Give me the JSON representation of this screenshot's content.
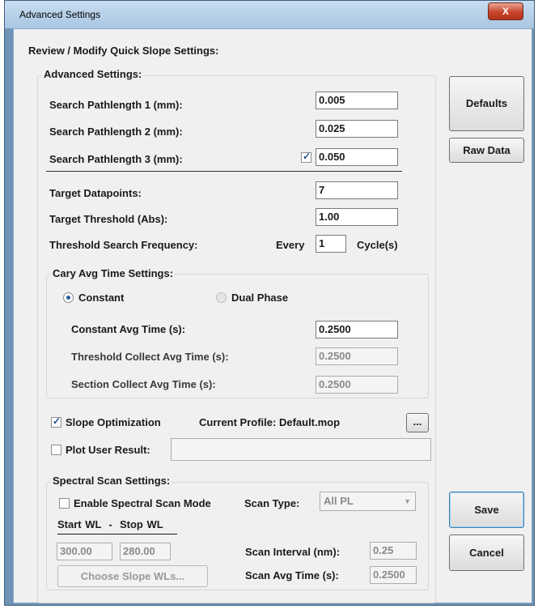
{
  "window": {
    "title": "Advanced Settings",
    "close_glyph": "X"
  },
  "header": "Review / Modify Quick Slope Settings:",
  "advanced": {
    "group_label": "Advanced Settings:",
    "path1_label": "Search Pathlength 1 (mm):",
    "path1_value": "0.005",
    "path2_label": "Search Pathlength 2 (mm):",
    "path2_value": "0.025",
    "path3_label": "Search Pathlength 3 (mm):",
    "path3_value": "0.050",
    "path3_checked": true,
    "target_dp_label": "Target Datapoints:",
    "target_dp_value": "7",
    "target_thr_label": "Target Threshold (Abs):",
    "target_thr_value": "1.00",
    "thr_freq_label": "Threshold Search Frequency:",
    "every_label": "Every",
    "every_value": "1",
    "cycles_label": "Cycle(s)"
  },
  "cary": {
    "group_label": "Cary Avg Time Settings:",
    "constant_label": "Constant",
    "dual_label": "Dual Phase",
    "selected": "Constant",
    "const_avg_label": "Constant Avg Time (s):",
    "const_avg_value": "0.2500",
    "thr_collect_label": "Threshold Collect Avg Time (s):",
    "thr_collect_value": "0.2500",
    "section_collect_label": "Section Collect Avg Time (s):",
    "section_collect_value": "0.2500"
  },
  "slope": {
    "opt_label": "Slope Optimization",
    "opt_checked": true,
    "profile_label": "Current Profile: Default.mop",
    "browse_label": "...",
    "plot_label": "Plot User Result:",
    "plot_checked": false,
    "plot_value": ""
  },
  "spectral": {
    "group_label": "Spectral Scan Settings:",
    "enable_label": "Enable Spectral Scan Mode",
    "enable_checked": false,
    "scan_type_label": "Scan Type:",
    "scan_type_value": "All PL",
    "wl_header": "Start WL  -  Stop WL",
    "start_wl": "300.00",
    "stop_wl": "280.00",
    "choose_label": "Choose Slope WLs...",
    "interval_label": "Scan Interval (nm):",
    "interval_value": "0.25",
    "avg_time_label": "Scan Avg Time (s):",
    "avg_time_value": "0.2500"
  },
  "buttons": {
    "defaults": "Defaults",
    "raw_data": "Raw Data",
    "save": "Save",
    "cancel": "Cancel"
  }
}
